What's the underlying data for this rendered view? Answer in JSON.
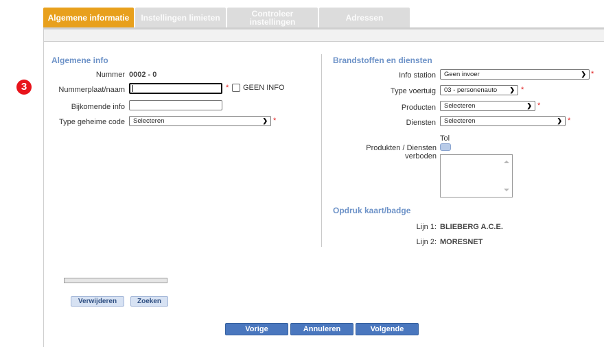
{
  "step_badge": "3",
  "tabs": [
    {
      "label": "Algemene informatie",
      "active": true
    },
    {
      "label": "Instellingen limieten",
      "active": false
    },
    {
      "label": "Controleer instellingen",
      "active": false
    },
    {
      "label": "Adressen",
      "active": false
    }
  ],
  "general": {
    "title": "Algemene info",
    "nummer_label": "Nummer",
    "nummer_value": "0002 - 0",
    "plate_label": "Nummerplaat/naam",
    "plate_value": "",
    "geen_info_label": "GEEN INFO",
    "extra_label": "Bijkomende info",
    "extra_value": "",
    "secret_label": "Type geheime code",
    "secret_selected": "Selecteren"
  },
  "fuel": {
    "title": "Brandstoffen en diensten",
    "info_station_label": "Info station",
    "info_station_selected": "Geen invoer",
    "vehicle_label": "Type voertuig",
    "vehicle_selected": "03 - personenauto",
    "products_label": "Producten",
    "products_selected": "Selecteren",
    "services_label": "Diensten",
    "services_selected": "Selecteren",
    "tol_label": "Tol",
    "forbidden_label_1": "Produkten / Diensten",
    "forbidden_label_2": "verboden"
  },
  "print": {
    "title": "Opdruk kaart/badge",
    "line1_label": "Lijn 1:",
    "line1_value": "BLIEBERG A.C.E.",
    "line2_label": "Lijn 2:",
    "line2_value": "MORESNET"
  },
  "buttons": {
    "delete": "Verwijderen",
    "search": "Zoeken",
    "prev": "Vorige",
    "cancel": "Annuleren",
    "next": "Volgende"
  },
  "colors": {
    "active_tab": "#e8a01c",
    "section_title": "#6e93c8",
    "nav_button": "#4a77be",
    "required": "#e01e1e",
    "badge": "#e8141b"
  }
}
